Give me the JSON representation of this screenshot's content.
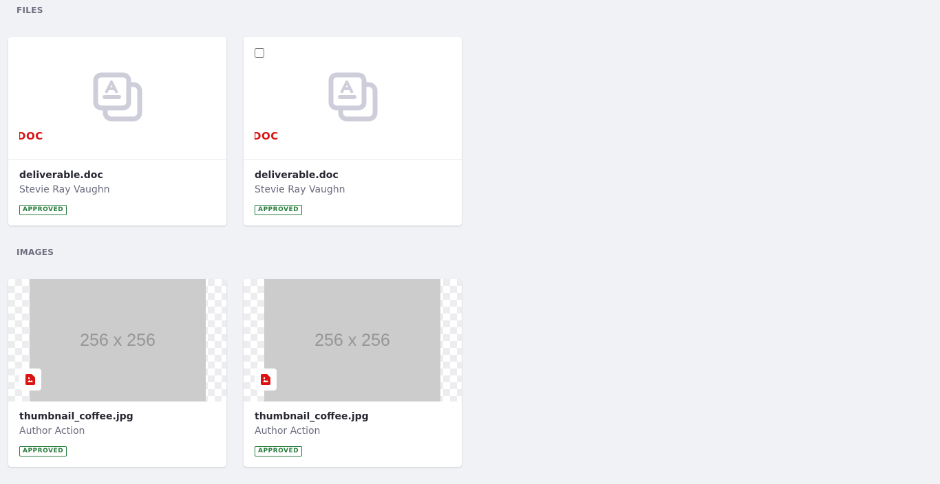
{
  "sections": {
    "files": {
      "label": "FILES"
    },
    "images": {
      "label": "IMAGES"
    }
  },
  "files": [
    {
      "title": "deliverable.doc",
      "author": "Stevie Ray Vaughn",
      "status": "APPROVED",
      "sticker": "DOC",
      "icon": "document-placeholder-icon",
      "selectable": false
    },
    {
      "title": "deliverable.doc",
      "author": "Stevie Ray Vaughn",
      "status": "APPROVED",
      "sticker": "DOC",
      "icon": "document-placeholder-icon",
      "selectable": true,
      "checked": false
    }
  ],
  "images": [
    {
      "title": "thumbnail_coffee.jpg",
      "author": "Author Action",
      "status": "APPROVED",
      "placeholder_text": "256 x 256",
      "icon": "image-file-icon"
    },
    {
      "title": "thumbnail_coffee.jpg",
      "author": "Author Action",
      "status": "APPROVED",
      "placeholder_text": "256 x 256",
      "icon": "image-file-icon"
    }
  ],
  "colors": {
    "background": "#f1f2f5",
    "sticker_red": "#da1414",
    "approved_green": "#287d3c",
    "placeholder_gray": "#cccccc",
    "icon_gray": "#cdced9"
  }
}
